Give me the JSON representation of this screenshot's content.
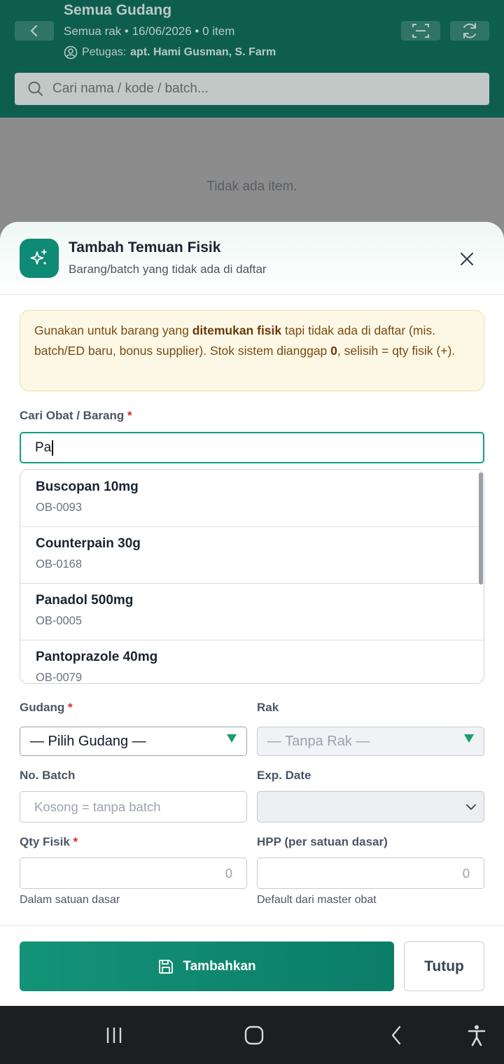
{
  "header": {
    "title": "Semua Gudang",
    "subtitle": "Semua rak • 16/06/2026 • 0 item",
    "officer_label": "Petugas:",
    "officer_name": "apt. Hami Gusman, S. Farm",
    "search_placeholder": "Cari nama / kode / batch..."
  },
  "background": {
    "empty_text": "Tidak ada item."
  },
  "sheet": {
    "title": "Tambah Temuan Fisik",
    "subtitle": "Barang/batch yang tidak ada di daftar",
    "notice": {
      "part1": "Gunakan untuk barang yang ",
      "bold1": "ditemukan fisik",
      "part2": " tapi tidak ada di daftar (mis. batch/ED baru, bonus supplier). Stok sistem dianggap ",
      "bold2": "0",
      "part3": ", selisih = qty fisik (+)."
    },
    "search": {
      "label": "Cari Obat / Barang",
      "required_mark": "*",
      "value": "Pa"
    },
    "suggestions": [
      {
        "name": "Buscopan 10mg",
        "code": "OB-0093"
      },
      {
        "name": "Counterpain 30g",
        "code": "OB-0168"
      },
      {
        "name": "Panadol 500mg",
        "code": "OB-0005"
      },
      {
        "name": "Pantoprazole 40mg",
        "code": "OB-0079"
      }
    ],
    "gudang": {
      "label": "Gudang",
      "required_mark": "*",
      "value": "— Pilih Gudang —"
    },
    "rak": {
      "label": "Rak",
      "value": "— Tanpa Rak —"
    },
    "batch": {
      "label": "No. Batch",
      "placeholder": "Kosong = tanpa batch"
    },
    "exp": {
      "label": "Exp. Date"
    },
    "qty": {
      "label": "Qty Fisik",
      "required_mark": "*",
      "placeholder": "0",
      "hint": "Dalam satuan dasar"
    },
    "hpp": {
      "label": "HPP (per satuan dasar)",
      "placeholder": "0",
      "hint": "Default dari master obat"
    },
    "submit_label": "Tambahkan",
    "close_label": "Tutup"
  },
  "colors": {
    "primary": "#0f8a74",
    "header_bg": "#0e5e50",
    "required": "#dc2626",
    "notice_bg": "#fdf8e6"
  },
  "icons": [
    "chevron-left-icon",
    "scan-icon",
    "refresh-icon",
    "user-circle-icon",
    "search-icon",
    "sparkles-icon",
    "close-icon",
    "triangle-down-icon",
    "chevron-down-icon",
    "save-icon",
    "recent-apps-icon",
    "home-icon",
    "back-icon",
    "accessibility-icon"
  ]
}
